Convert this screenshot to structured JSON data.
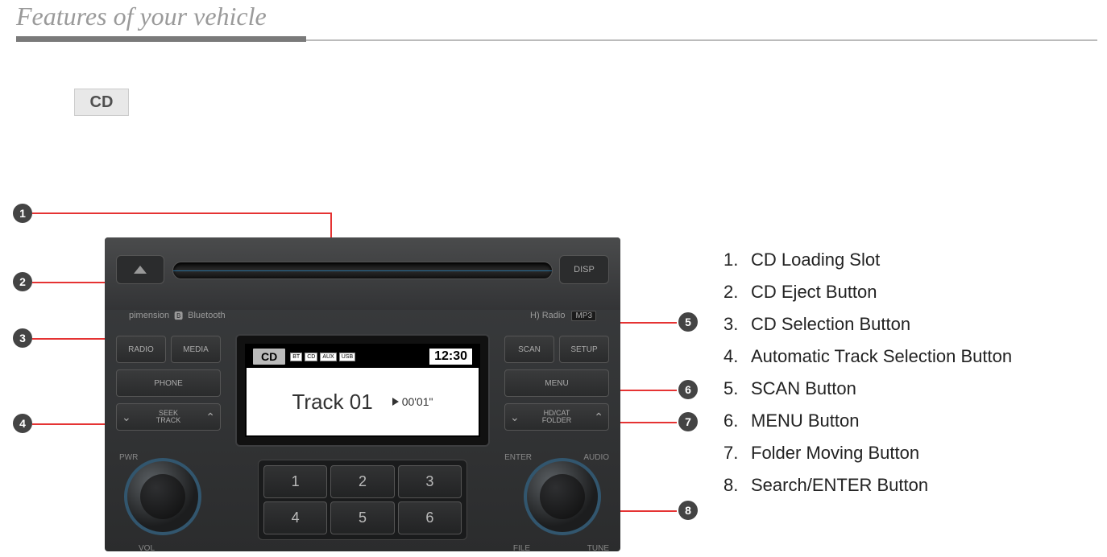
{
  "page": {
    "title": "Features of your vehicle"
  },
  "section": {
    "badge": "CD"
  },
  "callouts": [
    "1",
    "2",
    "3",
    "4",
    "5",
    "6",
    "7",
    "8"
  ],
  "radio": {
    "disp_label": "DISP",
    "brand_left": "pimension",
    "bluetooth": "Bluetooth",
    "hd_radio": "H) Radio",
    "mp3": "MP3",
    "buttons": {
      "radio": "RADIO",
      "media": "MEDIA",
      "phone": "PHONE",
      "scan": "SCAN",
      "setup": "SETUP",
      "menu": "MENU"
    },
    "rockers": {
      "seek_track_top": "SEEK",
      "seek_track_bot": "TRACK",
      "hd_cat_top": "HD/CAT",
      "hd_cat_bot": "FOLDER"
    },
    "knob_labels": {
      "pwr": "PWR",
      "vol": "VOL",
      "enter": "ENTER",
      "audio": "AUDIO",
      "file": "FILE",
      "tune": "TUNE"
    },
    "keypad": [
      "1",
      "2",
      "3",
      "4",
      "5",
      "6"
    ],
    "screen": {
      "mode": "CD",
      "icons": [
        "BT",
        "CD",
        "AUX",
        "USB"
      ],
      "time": "12:30",
      "track": "Track 01",
      "elapsed": "00'01\""
    }
  },
  "legend": [
    "CD Loading Slot",
    "CD Eject Button",
    "CD Selection Button",
    "Automatic Track Selection Button",
    "SCAN Button",
    "MENU Button",
    "Folder Moving Button",
    "Search/ENTER Button"
  ]
}
